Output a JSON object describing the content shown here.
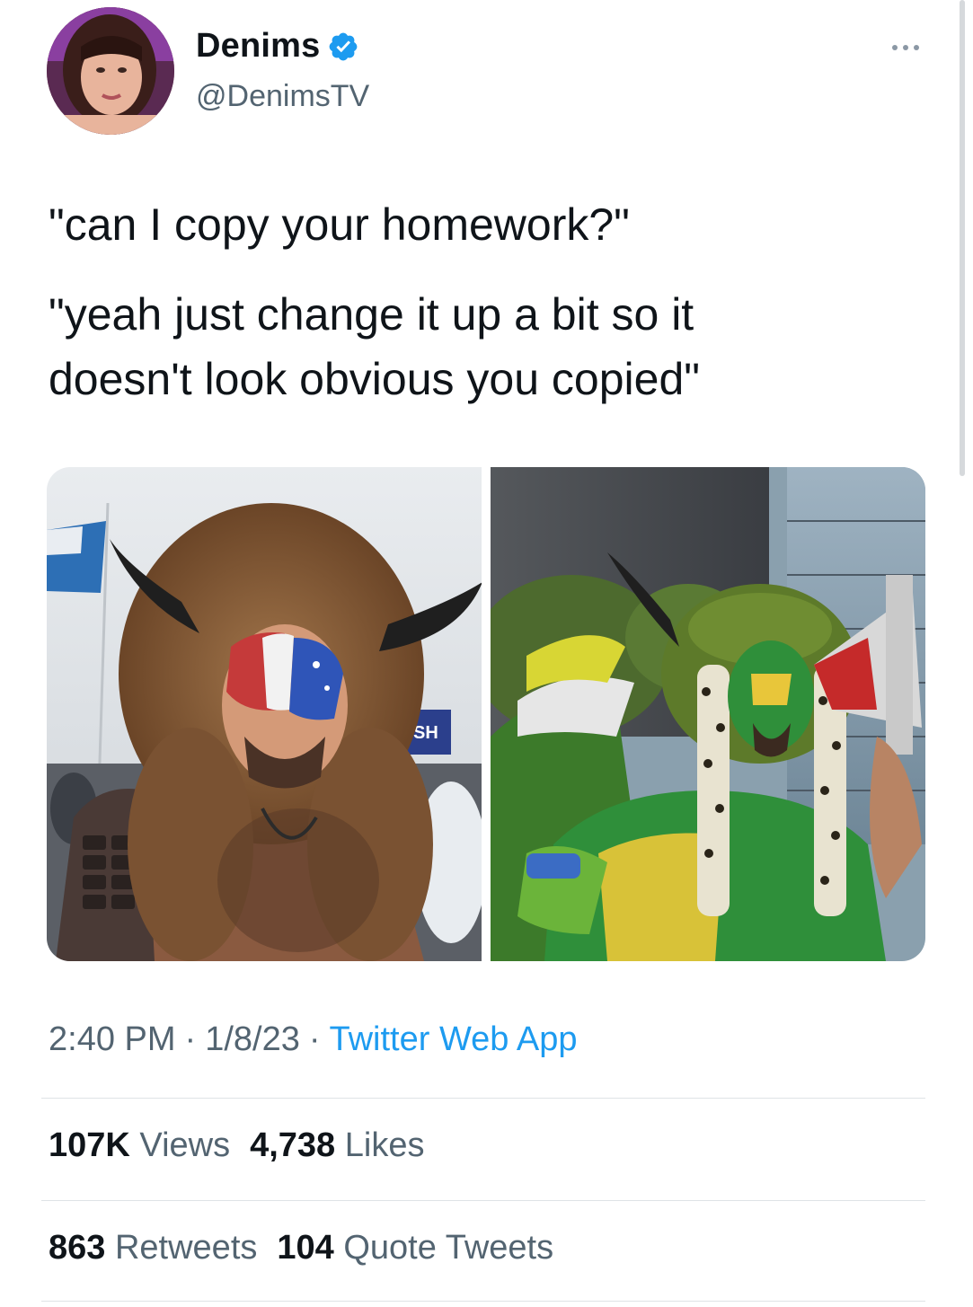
{
  "author": {
    "display_name": "Denims",
    "handle": "@DenimsTV",
    "verified": true
  },
  "tweet": {
    "lines": [
      "\"can I copy your homework?\"",
      "\"yeah just change it up a bit so it",
      "doesn't look obvious you copied\""
    ],
    "time": "2:40 PM",
    "date": "1/8/23",
    "separator": "·",
    "source": "Twitter Web App"
  },
  "stats": {
    "views_count": "107K",
    "views_label": "Views",
    "likes_count": "4,738",
    "likes_label": "Likes",
    "retweets_count": "863",
    "retweets_label": "Retweets",
    "quotes_count": "104",
    "quotes_label": "Quote Tweets"
  },
  "media": {
    "photo_1_sign_text": "SH"
  },
  "colors": {
    "text_primary": "#0f1419",
    "text_secondary": "#536471",
    "accent": "#1d9bf0",
    "divider": "#dfe3e6"
  },
  "icons": {
    "verified": "verified-badge-icon",
    "more": "more-options-icon"
  }
}
